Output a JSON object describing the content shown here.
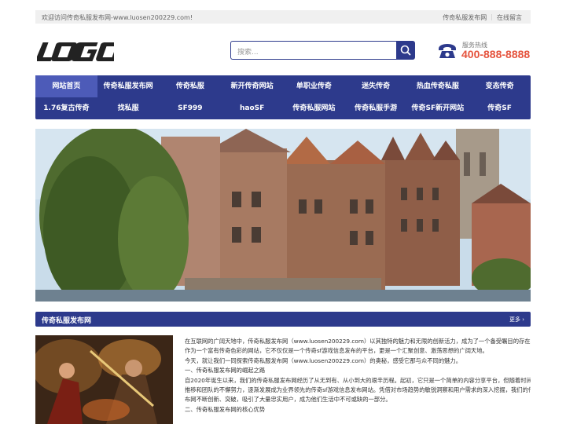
{
  "topbar": {
    "welcome": "欢迎访问传奇私服发布网-www.luosen200229.com!",
    "links": [
      "传奇私服发布网",
      "在线留言"
    ]
  },
  "logo": {
    "text": "LOGO"
  },
  "search": {
    "placeholder": "搜索..."
  },
  "hotline": {
    "label": "服务热线",
    "number": "400-888-8888"
  },
  "nav": {
    "row1": [
      "网站首页",
      "传奇私服发布网",
      "传奇私服",
      "新开传奇网站",
      "单职业传奇",
      "迷失传奇",
      "热血传奇私服",
      "变态传奇"
    ],
    "row2": [
      "1.76复古传奇",
      "找私服",
      "SF999",
      "haoSF",
      "传奇私服网站",
      "传奇私服手游",
      "传奇SF新开网站",
      "传奇SF"
    ]
  },
  "section": {
    "title": "传奇私服发布网",
    "more": "更多"
  },
  "article": {
    "lines": [
      "在互联网的广阔天地中，传奇私服发布网（www.luosen200229.com）以其独特的魅力和无限的创新活力，成为了一个备受瞩目的存在。",
      "作为一个富有传奇色彩的网站，它不仅仅是一个传奇sf游戏信息发布的平台，更是一个汇聚创意、激荡思想的广阔天地。",
      "今天，就让我们一同探索传奇私服发布网（www.luosen200229.com）的奥秘，感受它那与众不同的魅力。",
      "一、传奇私服发布网的崛起之路",
      "自2020年诞生以来，我们的传奇私服发布网经历了从无到有、从小到大的艰辛历程。起初，它只是一个简单的内容分享平台，但随着时间的",
      "推移和团队的不懈努力，逐渐发展成为业界领先的传奇sf游戏信息发布网站。凭借对市场趋势的敏锐洞察和用户需求的深入挖掘，我们的传奇私服发",
      "布网不断创新、突破，吸引了大量忠实用户，成为他们生活中不可或缺的一部分。",
      "二、传奇私服发布网的核心优势"
    ]
  },
  "colors": {
    "primary": "#2d3a8c",
    "accent": "#e5533d",
    "nav_active": "#4d5bb8"
  }
}
